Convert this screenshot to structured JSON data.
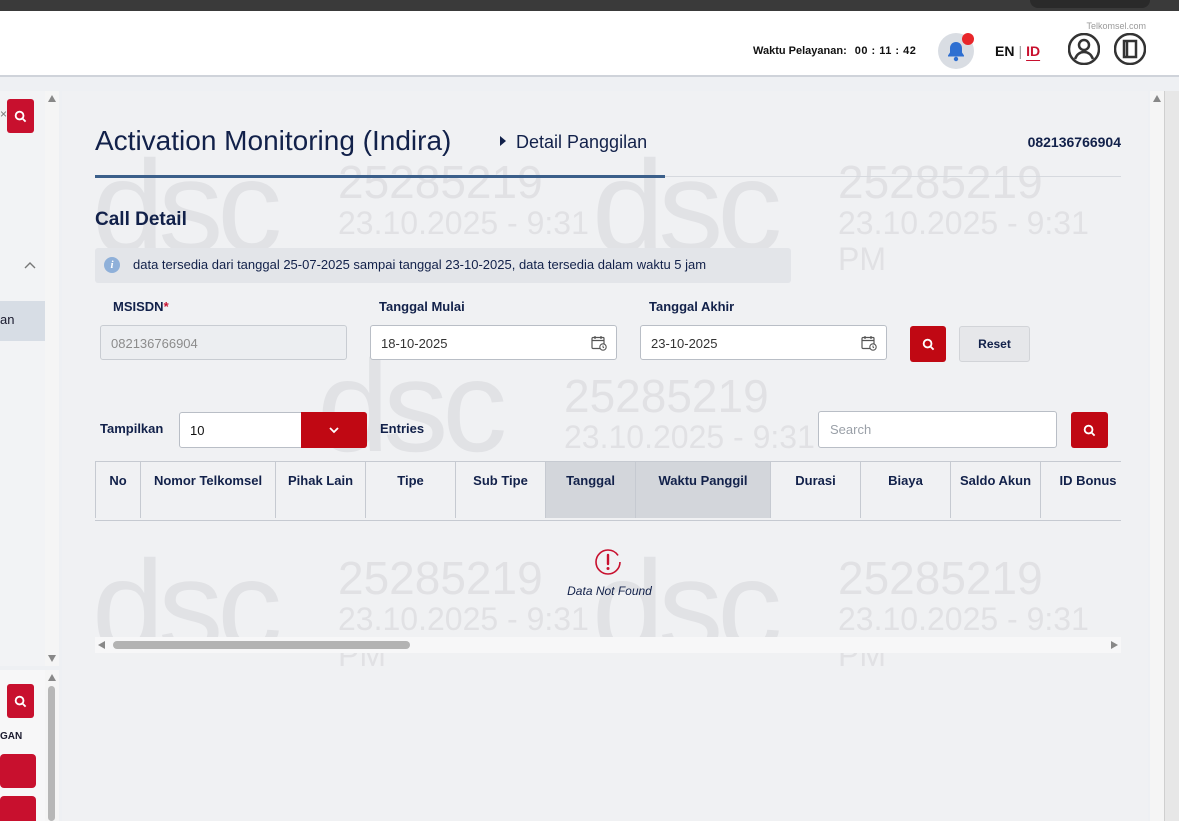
{
  "header": {
    "brand": "Telkomsel.com",
    "service_time_label": "Waktu Pelayanan:",
    "service_time_value": "00 : 11 : 42",
    "lang_en": "EN",
    "lang_sep": "|",
    "lang_id": "ID",
    "icons": [
      "bell-icon",
      "user-icon",
      "logout-icon"
    ]
  },
  "left_panel": {
    "label_fragment": "an",
    "lower_label_fragment": "GAN"
  },
  "watermark": {
    "id": "25285219",
    "datetime": "23.10.2025 - 9:31",
    "ampm": "PM",
    "logo": "dsc"
  },
  "page": {
    "title": "Activation Monitoring (Indira)",
    "breadcrumb": "Detail Panggilan",
    "msisdn": "082136766904",
    "section_title": "Call Detail",
    "info_text": "data tersedia dari tanggal 25-07-2025 sampai tanggal 23-10-2025, data tersedia dalam waktu 5 jam"
  },
  "form": {
    "msisdn_label": "MSISDN",
    "required_mark": "*",
    "msisdn_value": "082136766904",
    "start_label": "Tanggal Mulai",
    "start_value": "18-10-2025",
    "end_label": "Tanggal Akhir",
    "end_value": "23-10-2025",
    "reset_label": "Reset"
  },
  "table_controls": {
    "show_label": "Tampilkan",
    "entries_value": "10",
    "entries_label": "Entries",
    "search_placeholder": "Search"
  },
  "table": {
    "columns": [
      "No",
      "Nomor Telkomsel",
      "Pihak Lain",
      "Tipe",
      "Sub Tipe",
      "Tanggal",
      "Waktu Panggil",
      "Durasi",
      "Biaya",
      "Saldo Akun",
      "ID Bonus"
    ],
    "empty_text": "Data Not Found"
  },
  "colors": {
    "accent": "#c00813",
    "title": "#12214a",
    "underline": "#3b5f8a"
  }
}
